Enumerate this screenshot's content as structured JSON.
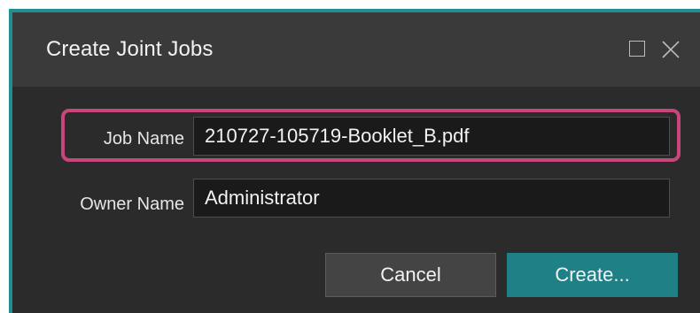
{
  "dialog": {
    "title": "Create Joint Jobs",
    "window_buttons": {
      "maximize_icon": "maximize-square-icon",
      "close_icon": "close-x-icon"
    }
  },
  "form": {
    "job_name": {
      "label": "Job Name",
      "value": "210727-105719-Booklet_B.pdf"
    },
    "owner_name": {
      "label": "Owner Name",
      "value": "Administrator"
    }
  },
  "buttons": {
    "cancel_label": "Cancel",
    "create_label": "Create..."
  },
  "colors": {
    "accent": "#1f8086",
    "highlight": "#c9467a",
    "dialog_bg": "#2d2d2d",
    "titlebar_bg": "#3a3a3a"
  }
}
